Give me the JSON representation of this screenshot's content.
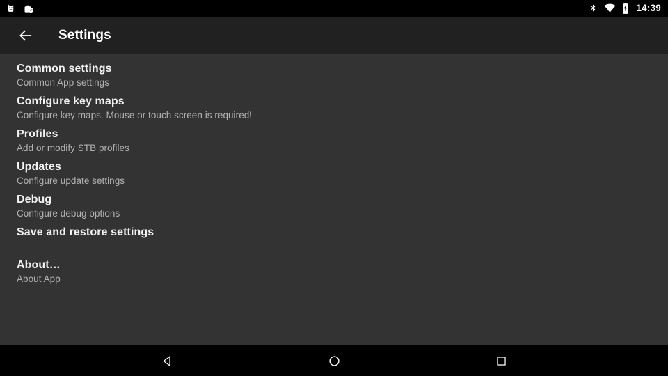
{
  "status_bar": {
    "left_icons": [
      {
        "name": "android-bug-icon",
        "label": "Android debug notification"
      },
      {
        "name": "work-badge-icon",
        "label": "Work profile clipboard"
      }
    ],
    "right_icons": [
      {
        "name": "bluetooth-icon",
        "label": "Bluetooth"
      },
      {
        "name": "wifi-icon",
        "label": "Wi-Fi"
      },
      {
        "name": "battery-charging-icon",
        "label": "Battery charging"
      }
    ],
    "clock": "14:39"
  },
  "app_bar": {
    "back_label": "Back",
    "title": "Settings"
  },
  "settings": {
    "items": [
      {
        "title": "Common settings",
        "subtitle": "Common App settings"
      },
      {
        "title": "Configure key maps",
        "subtitle": "Configure key maps. Mouse or touch screen is required!"
      },
      {
        "title": "Profiles",
        "subtitle": "Add or modify STB profiles"
      },
      {
        "title": "Updates",
        "subtitle": "Configure update settings"
      },
      {
        "title": "Debug",
        "subtitle": "Configure debug options"
      },
      {
        "title": "Save and restore settings",
        "subtitle": ""
      },
      {
        "title": "About…",
        "subtitle": "About App"
      }
    ]
  },
  "nav_bar": {
    "back_label": "Back",
    "home_label": "Home",
    "recents_label": "Recent apps"
  },
  "colors": {
    "status_bar_bg": "#000000",
    "app_bar_bg": "#212121",
    "content_bg": "#333333",
    "nav_bar_bg": "#000000",
    "title_text": "#f2f2f2",
    "subtitle_text": "#b3b3b3",
    "icon_white": "#ffffff"
  }
}
